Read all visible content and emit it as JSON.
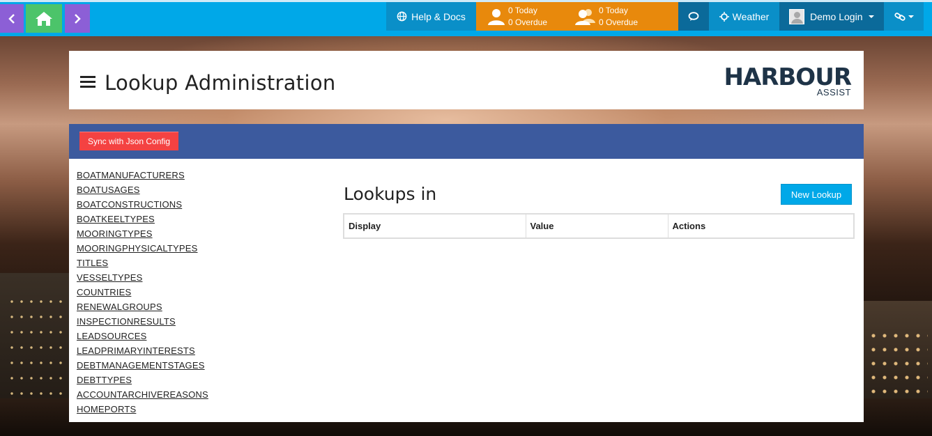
{
  "nav": {
    "back_icon": "chevron-left-icon",
    "home_icon": "home-icon",
    "forward_icon": "chevron-right-icon"
  },
  "topbar": {
    "help_label": "Help & Docs",
    "tasks_mine": {
      "today": "0 Today",
      "overdue": "0 Overdue"
    },
    "tasks_team": {
      "today": "0 Today",
      "overdue": "0 Overdue"
    },
    "weather_label": "Weather",
    "user_label": "Demo Login"
  },
  "header": {
    "title": "Lookup Administration",
    "logo_main": "HARBOUR",
    "logo_sub": "ASSIST"
  },
  "toolbar": {
    "sync_label": "Sync with Json Config"
  },
  "lookups": [
    "BOATMANUFACTURERS",
    "BOATUSAGES",
    "BOATCONSTRUCTIONS",
    "BOATKEELTYPES",
    "MOORINGTYPES",
    "MOORINGPHYSICALTYPES",
    "TITLES",
    "VESSELTYPES",
    "COUNTRIES",
    "RENEWALGROUPS",
    "INSPECTIONRESULTS",
    "LEADSOURCES",
    "LEADPRIMARYINTERESTS",
    "DEBTMANAGEMENTSTAGES",
    "DEBTTYPES",
    "ACCOUNTARCHIVEREASONS",
    "HOMEPORTS"
  ],
  "main": {
    "section_title": "Lookups in",
    "new_button": "New Lookup",
    "columns": [
      "Display",
      "Value",
      "Actions"
    ]
  },
  "colors": {
    "topbar": "#00a8e8",
    "tasks": "#e8890c",
    "toolbar": "#3c5a9e",
    "sync_button": "#f44242",
    "new_button": "#00a8e8"
  }
}
